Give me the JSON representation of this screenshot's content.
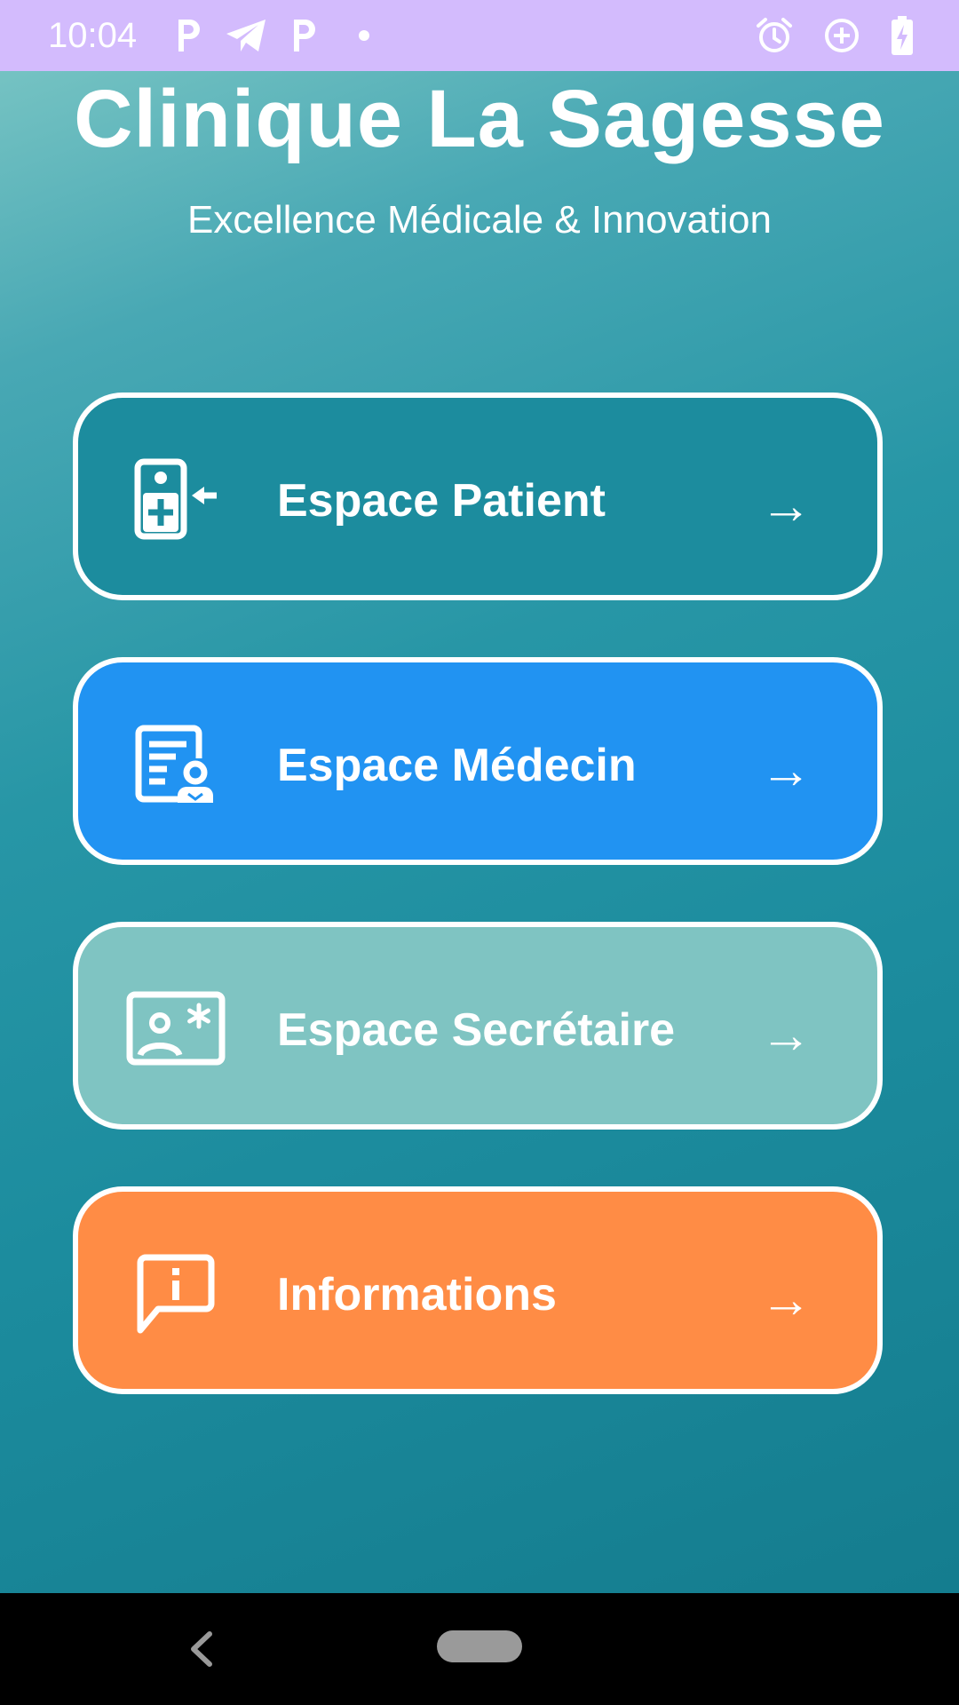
{
  "status_bar": {
    "time": "10:04",
    "background": "#d3bbfd",
    "left_icons": [
      "parking-icon",
      "telegram-icon",
      "parking-icon",
      "dot-icon"
    ],
    "right_icons": [
      "alarm-icon",
      "data-saver-icon",
      "battery-charging-icon"
    ]
  },
  "header": {
    "title": "Clinique La Sagesse",
    "subtitle": "Excellence Médicale & Innovation"
  },
  "menu": {
    "items": [
      {
        "label": "Espace Patient",
        "arrow": "→",
        "icon": "patient-badge-icon",
        "color": "#1c8c9e"
      },
      {
        "label": "Espace Médecin",
        "arrow": "→",
        "icon": "doctor-document-icon",
        "color": "#2193f2"
      },
      {
        "label": "Espace Secrétaire",
        "arrow": "→",
        "icon": "contact-card-icon",
        "color": "#7fc4c2"
      },
      {
        "label": "Informations",
        "arrow": "→",
        "icon": "info-message-icon",
        "color": "#ff8c45"
      }
    ]
  },
  "nav_bar": {
    "icons": [
      "back-icon",
      "home-pill-icon"
    ]
  }
}
